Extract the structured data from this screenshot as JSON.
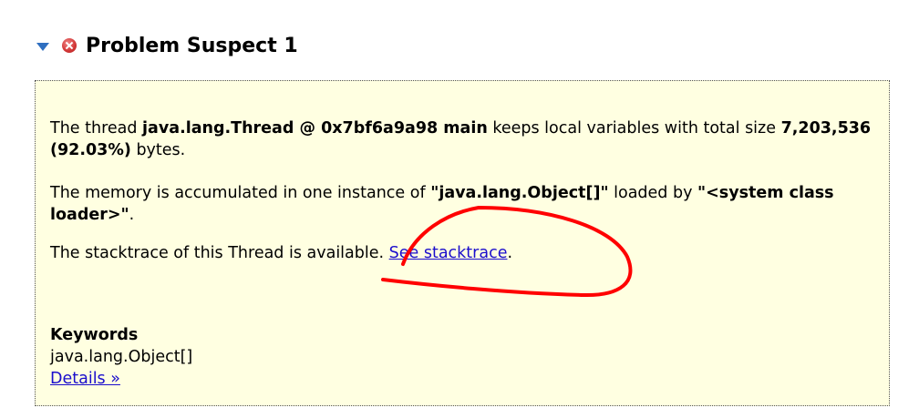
{
  "header": {
    "title": "Problem Suspect 1",
    "expand_icon": "triangle-down-icon",
    "status_icon": "error-x-icon"
  },
  "suspect": {
    "p1_prefix": "The thread ",
    "thread_name": "java.lang.Thread @ 0x7bf6a9a98 main",
    "p1_mid": " keeps local variables with total size ",
    "size": "7,203,536 (92.03%)",
    "p1_suffix": " bytes.",
    "p2_prefix": "The memory is accumulated in one instance of ",
    "object_type": "\"java.lang.Object[]\"",
    "p2_mid": " loaded by ",
    "loader": "\"<system class loader>\"",
    "p2_suffix": ".",
    "p3_prefix": "The stacktrace of this Thread is available. ",
    "stacktrace_link": "See stacktrace",
    "p3_suffix": "."
  },
  "keywords": {
    "title": "Keywords",
    "item": "java.lang.Object[]",
    "details_link": "Details »"
  },
  "colors": {
    "panel_bg": "#ffffe1",
    "link": "#1a0dcc",
    "twisty": "#2f6fc0",
    "annotation": "#ff0000"
  }
}
